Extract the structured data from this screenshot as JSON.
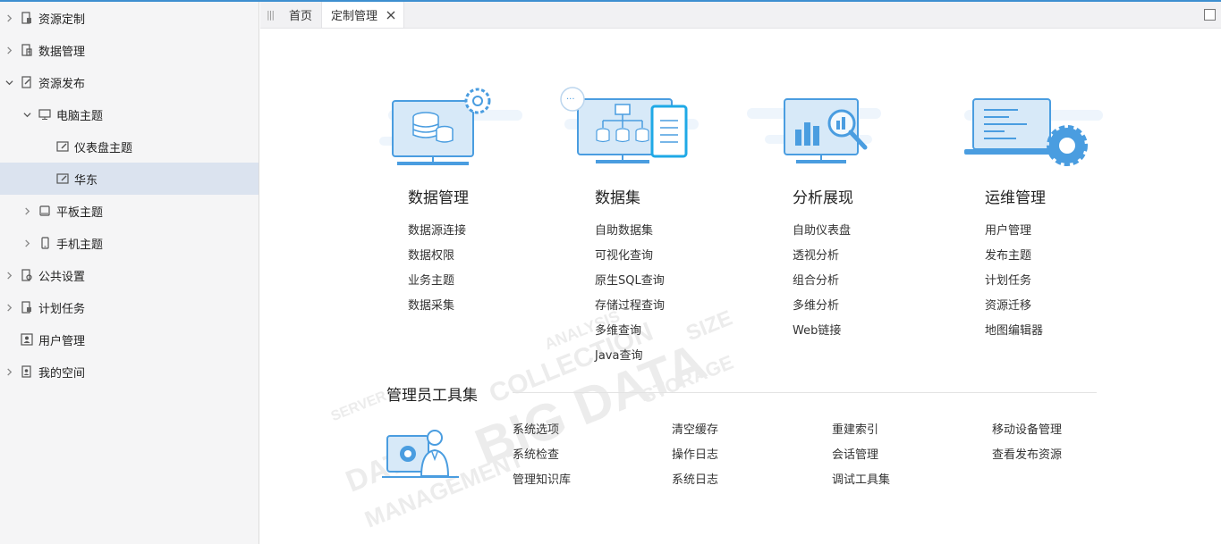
{
  "sidebar": {
    "items": [
      {
        "label": "资源定制",
        "icon": "resource-custom-icon",
        "caret": "right",
        "level": 0
      },
      {
        "label": "数据管理",
        "icon": "data-management-icon",
        "caret": "right",
        "level": 0
      },
      {
        "label": "资源发布",
        "icon": "resource-publish-icon",
        "caret": "down",
        "level": 0
      },
      {
        "label": "电脑主题",
        "icon": "desktop-icon",
        "caret": "down",
        "level": 1
      },
      {
        "label": "仪表盘主题",
        "icon": "dashboard-theme-icon",
        "caret": "none",
        "level": 2
      },
      {
        "label": "华东",
        "icon": "dashboard-theme-icon",
        "caret": "none",
        "level": 2,
        "selected": true
      },
      {
        "label": "平板主题",
        "icon": "tablet-icon",
        "caret": "right",
        "level": 1
      },
      {
        "label": "手机主题",
        "icon": "phone-icon",
        "caret": "right",
        "level": 1
      },
      {
        "label": "公共设置",
        "icon": "public-settings-icon",
        "caret": "right",
        "level": 0
      },
      {
        "label": "计划任务",
        "icon": "scheduled-task-icon",
        "caret": "right",
        "level": 0
      },
      {
        "label": "用户管理",
        "icon": "user-management-icon",
        "caret": "none",
        "level": 0
      },
      {
        "label": "我的空间",
        "icon": "my-space-icon",
        "caret": "right",
        "level": 0
      }
    ]
  },
  "tabs": [
    {
      "label": "首页",
      "active": false
    },
    {
      "label": "定制管理",
      "active": true
    }
  ],
  "modules": [
    {
      "title": "数据管理",
      "icon": "data-management-illustration",
      "links": [
        "数据源连接",
        "数据权限",
        "业务主题",
        "数据采集"
      ]
    },
    {
      "title": "数据集",
      "icon": "dataset-illustration",
      "links": [
        "自助数据集",
        "可视化查询",
        "原生SQL查询",
        "存储过程查询",
        "多维查询",
        "Java查询"
      ]
    },
    {
      "title": "分析展现",
      "icon": "analysis-illustration",
      "links": [
        "自助仪表盘",
        "透视分析",
        "组合分析",
        "多维分析",
        "Web链接"
      ]
    },
    {
      "title": "运维管理",
      "icon": "operations-illustration",
      "links": [
        "用户管理",
        "发布主题",
        "计划任务",
        "资源迁移",
        "地图编辑器"
      ]
    }
  ],
  "admin_tools": {
    "title": "管理员工具集",
    "icon": "admin-tools-illustration",
    "columns": [
      [
        "系统选项",
        "系统检查",
        "管理知识库"
      ],
      [
        "清空缓存",
        "操作日志",
        "系统日志"
      ],
      [
        "重建索引",
        "会话管理",
        "调试工具集"
      ],
      [
        "移动设备管理",
        "查看发布资源"
      ]
    ]
  },
  "colors": {
    "accent": "#3d8fd0",
    "illustration": "#4a9de0",
    "selected_row": "#dbe3ef"
  }
}
